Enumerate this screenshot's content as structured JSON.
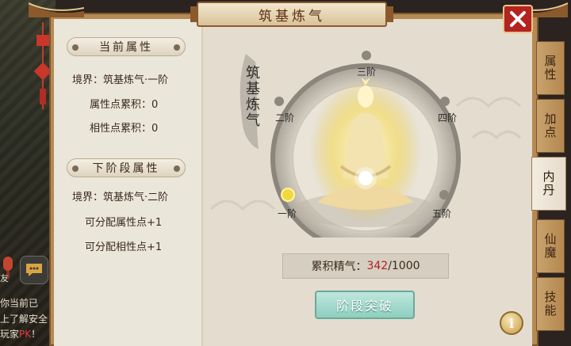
{
  "window": {
    "title": "筑基炼气"
  },
  "current_attrs": {
    "header": "当前属性",
    "realm": "境界：筑基炼气·一阶",
    "attr_points": "属性点累积：0",
    "phase_points": "相性点累积：0"
  },
  "next_attrs": {
    "header": "下阶段属性",
    "realm": "境界：筑基炼气·二阶",
    "attr_bonus": "可分配属性点+1",
    "phase_bonus": "可分配相性点+1"
  },
  "stages": [
    "一阶",
    "二阶",
    "三阶",
    "四阶",
    "五阶"
  ],
  "current_stage_index": 0,
  "brush_title": "筑基炼气",
  "progress": {
    "label": "累积精气：",
    "current": "342",
    "max": "/1000",
    "fraction": 0.342
  },
  "breakthrough_button": "阶段突破",
  "tabs": [
    {
      "label": "属性",
      "active": false
    },
    {
      "label": "加点",
      "active": false
    },
    {
      "label": "内丹",
      "active": true
    },
    {
      "label": "仙魔",
      "active": false
    },
    {
      "label": "技能",
      "active": false
    }
  ],
  "chat": {
    "lines": [
      "你当前已",
      "上了解安全",
      "玩家PK！"
    ],
    "badge": "友"
  },
  "info_icon": "i",
  "colors": {
    "accent_red": "#b21e1e",
    "button_green": "#8dcfc0",
    "frame_brown": "#b58a53"
  }
}
